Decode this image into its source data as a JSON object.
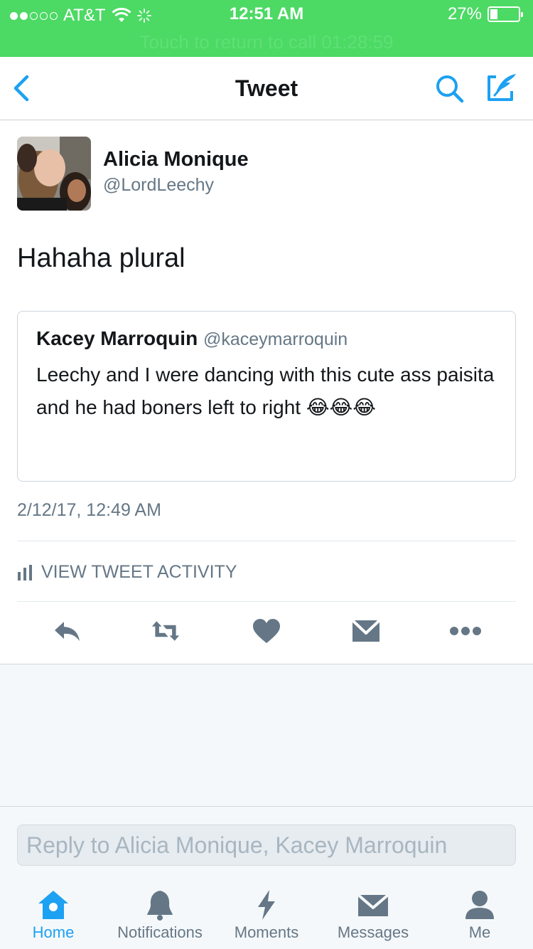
{
  "status_bar": {
    "carrier": "AT&T",
    "time": "12:51 AM",
    "battery": "27%",
    "battery_level": 0.27,
    "call_banner": "Touch to return to call 01:28:59"
  },
  "nav": {
    "title": "Tweet"
  },
  "tweet": {
    "author_name": "Alicia Monique",
    "author_handle": "@LordLeechy",
    "text": "Hahaha plural",
    "quoted": {
      "name": "Kacey Marroquin",
      "handle": "@kaceymarroquin",
      "text": "Leechy and I were dancing with this cute ass paisita and he had boners left to right 😂😂😂"
    },
    "timestamp": "2/12/17, 12:49 AM",
    "activity_label": "VIEW TWEET ACTIVITY"
  },
  "reply": {
    "placeholder": "Reply to Alicia Monique, Kacey Marroquin"
  },
  "tabs": [
    {
      "label": "Home",
      "icon": "home-icon"
    },
    {
      "label": "Notifications",
      "icon": "bell-icon"
    },
    {
      "label": "Moments",
      "icon": "lightning-icon"
    },
    {
      "label": "Messages",
      "icon": "envelope-icon"
    },
    {
      "label": "Me",
      "icon": "person-icon"
    }
  ],
  "colors": {
    "accent": "#1da1f2",
    "status_bar": "#4cd964",
    "muted": "#657786"
  }
}
